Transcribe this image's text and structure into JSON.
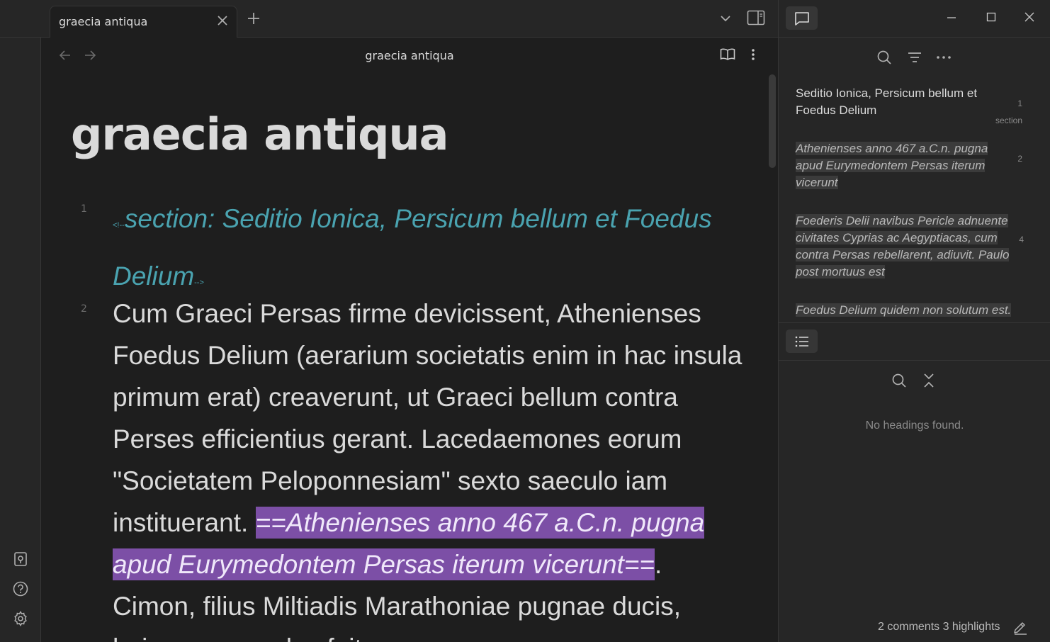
{
  "tab": {
    "title": "graecia antiqua"
  },
  "view_header": {
    "title": "graecia antiqua"
  },
  "note": {
    "inline_title": "graecia antiqua",
    "lines": [
      {
        "number": "1",
        "prefix": "<!--",
        "text": "section: Seditio Ionica, Persicum bellum et Foedus Delium",
        "suffix": "-->"
      },
      {
        "number": "2",
        "text_before": "Cum Graeci Persas firme devicissent, Athenienses Foedus Delium (aerarium societatis enim in hac insula primum erat) creaverunt, ut Graeci bellum contra Perses efficientius gerant. Lacedaemones eorum \"Societatem Peloponnesiam\" sexto saeculo iam instituerant. ",
        "highlight": "==Athenienses anno 467 a.C.n. pugna apud Eurymedontem Persas iterum vicerunt==",
        "text_after": ". Cimon, filius Miltiadis Marathoniae pugnae ducis, huius pugnae dux fuit."
      }
    ]
  },
  "comments_panel": {
    "items": [
      {
        "type": "heading",
        "text": "Seditio Ionica, Persicum bellum et Foedus Delium",
        "line": "1",
        "tag": "section"
      },
      {
        "type": "highlight",
        "text": "Athenienses anno 467 a.C.n. pugna apud Eurymedontem Persas iterum vicerunt",
        "line": "2"
      },
      {
        "type": "highlight",
        "text": "Foederis Delii navibus Pericle adnuente civitates Cyprias ac Aegyptiacas, cum contra Persas rebellarent, adiuvit. Paulo post mortuus est",
        "line": "4"
      },
      {
        "type": "highlight",
        "text": "Foedus Delium quidem non solutum est.",
        "line": ""
      }
    ]
  },
  "outline_panel": {
    "empty_text": "No headings found."
  },
  "status_bar": {
    "counts": "2 comments 3 highlights"
  },
  "colors": {
    "accent_highlight": "#7c4fa6",
    "comment_color": "#4aa3b0",
    "background": "#1e1e1e"
  }
}
